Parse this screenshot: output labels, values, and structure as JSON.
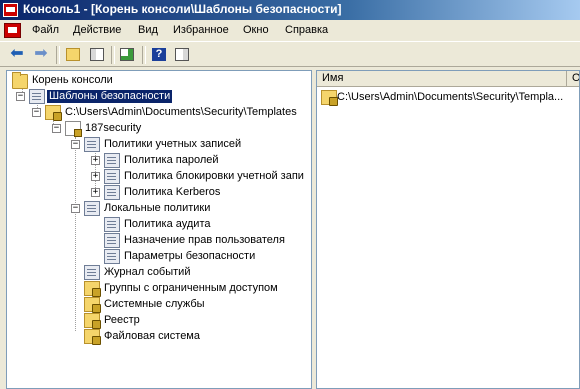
{
  "window": {
    "title": "Консоль1 - [Корень консоли\\Шаблоны безопасности]"
  },
  "menu": [
    "Файл",
    "Действие",
    "Вид",
    "Избранное",
    "Окно",
    "Справка"
  ],
  "tree": {
    "root": "Корень консоли",
    "templates": "Шаблоны безопасности",
    "path": "C:\\Users\\Admin\\Documents\\Security\\Templates",
    "template": "187security",
    "account_policies": "Политики учетных записей",
    "password_policy": "Политика паролей",
    "lockout_policy": "Политика блокировки учетной запи",
    "kerberos_policy": "Политика Kerberos",
    "local_policies": "Локальные политики",
    "audit_policy": "Политика аудита",
    "user_rights": "Назначение прав пользователя",
    "security_options": "Параметры безопасности",
    "event_log": "Журнал событий",
    "restricted_groups": "Группы с ограниченным доступом",
    "system_services": "Системные службы",
    "registry": "Реестр",
    "file_system": "Файловая система"
  },
  "list": {
    "columns": [
      "Имя",
      "О"
    ],
    "rows": [
      "C:\\Users\\Admin\\Documents\\Security\\Templa..."
    ]
  }
}
